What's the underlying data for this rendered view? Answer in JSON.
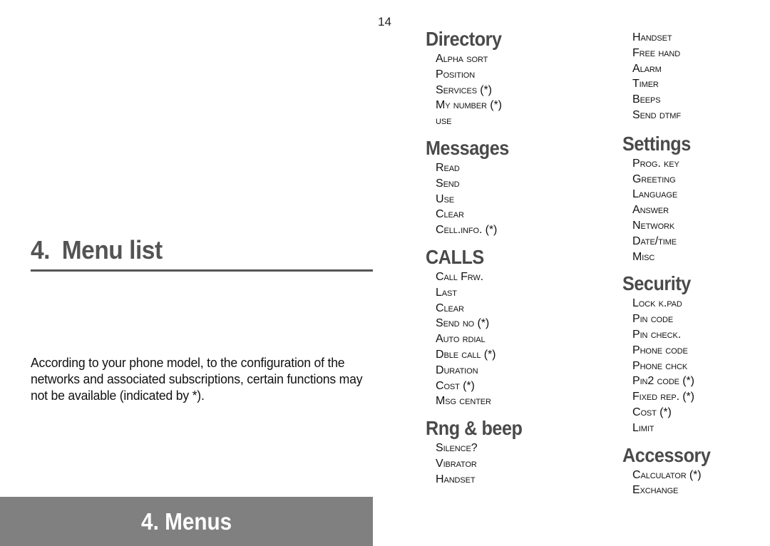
{
  "page_number": "14",
  "chapter": {
    "number": "4.",
    "title": "Menu list"
  },
  "intro_text": "According to your phone model, to the configuration of the networks and associated subscriptions, certain functions may not be available (indicated by *).",
  "footer": {
    "label": "4. Menus",
    "band_color": "#808080"
  },
  "columns": [
    {
      "sections": [
        {
          "title": "Directory",
          "items": [
            "Alpha sort",
            "Position",
            "Services (*)",
            "My number (*)",
            "use"
          ]
        },
        {
          "title": "Messages",
          "items": [
            "Read",
            "Send",
            "Use",
            "Clear",
            "Cell.info. (*)"
          ]
        },
        {
          "title": "CALLS",
          "items": [
            "Call Frw.",
            "Last",
            "Clear",
            "Send no (*)",
            "Auto rdial",
            "Dble call (*)",
            "Duration",
            "Cost (*)",
            "Msg center"
          ]
        },
        {
          "title": "Rng & beep",
          "items": [
            "Silence?",
            "Vibrator",
            "Handset"
          ]
        }
      ]
    },
    {
      "sections": [
        {
          "title": "",
          "items": [
            "Handset",
            "Free hand",
            "Alarm",
            "Timer",
            "Beeps",
            "Send dtmf"
          ]
        },
        {
          "title": "Settings",
          "items": [
            "Prog. key",
            "Greeting",
            "Language",
            "Answer",
            "Network",
            "Date/time",
            "Misc"
          ]
        },
        {
          "title": "Security",
          "items": [
            "Lock k.pad",
            "Pin code",
            "Pin check.",
            "Phone code",
            "Phone chck",
            "Pin2 code (*)",
            "Fixed rep. (*)",
            "Cost (*)",
            "Limit"
          ]
        },
        {
          "title": "Accessory",
          "items": [
            "Calculator (*)",
            "Exchange"
          ]
        }
      ]
    }
  ]
}
